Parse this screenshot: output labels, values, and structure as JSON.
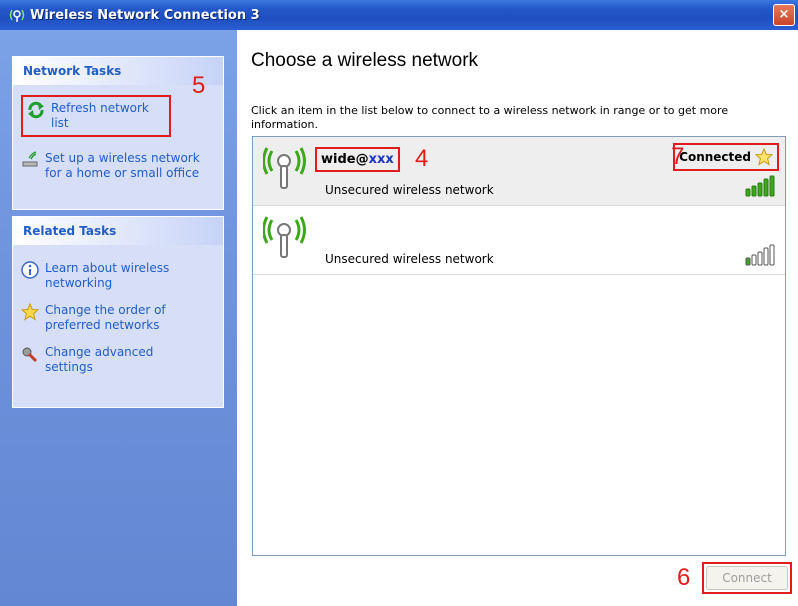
{
  "window": {
    "title": "Wireless Network Connection 3",
    "close_glyph": "×"
  },
  "network_tasks": {
    "header": "Network Tasks",
    "items": [
      {
        "label": "Refresh network list",
        "icon": "refresh-icon"
      },
      {
        "label": "Set up a wireless network for a home or small office",
        "icon": "wireless-setup-icon"
      }
    ]
  },
  "related_tasks": {
    "header": "Related Tasks",
    "items": [
      {
        "label": "Learn about wireless networking",
        "icon": "info-icon"
      },
      {
        "label": "Change the order of preferred networks",
        "icon": "star-icon"
      },
      {
        "label": "Change advanced settings",
        "icon": "settings-icon"
      }
    ]
  },
  "main": {
    "title": "Choose a wireless network",
    "description": "Click an item in the list below to connect to a wireless network in range or to get more information."
  },
  "networks": [
    {
      "ssid_prefix": "wide@",
      "ssid_suffix": "xxx",
      "security": "Unsecured wireless network",
      "status": "Connected",
      "signal_bars": 5,
      "selected": true
    },
    {
      "ssid_prefix": "",
      "ssid_suffix": "",
      "security": "Unsecured wireless network",
      "status": "",
      "signal_bars": 1,
      "selected": false
    }
  ],
  "connect_button": {
    "label": "Connect",
    "enabled": false
  },
  "annotations": {
    "n4": "4",
    "n5": "5",
    "n6": "6",
    "n7": "7"
  },
  "colors": {
    "annotation": "#e21b1b",
    "link": "#215dc6",
    "signal_on": "#3ea81d",
    "signal_off": "#ffffff"
  }
}
